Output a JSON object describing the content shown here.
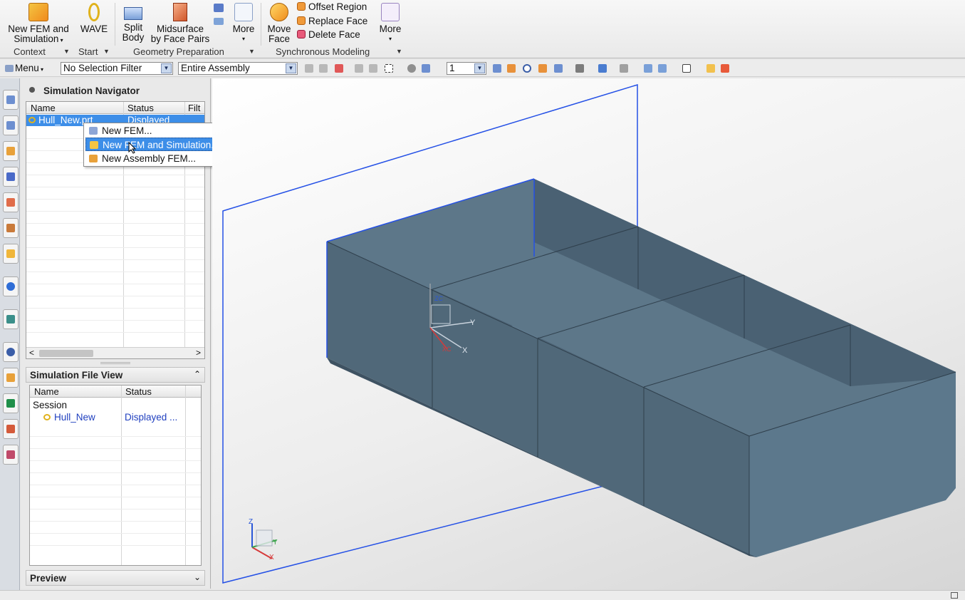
{
  "ribbon": {
    "new_fem_label_1": "New FEM and",
    "new_fem_label_2": "Simulation",
    "wave_label": "WAVE",
    "split_label_1": "Split",
    "split_label_2": "Body",
    "midsurface_label_1": "Midsurface",
    "midsurface_label_2": "by Face Pairs",
    "more1_label": "More",
    "move_face_label_1": "Move",
    "move_face_label_2": "Face",
    "offset_region": "Offset Region",
    "replace_face": "Replace Face",
    "delete_face": "Delete Face",
    "more2_label": "More",
    "groups": {
      "context": "Context",
      "start": "Start",
      "geometry_preparation": "Geometry Preparation",
      "synchronous_modeling": "Synchronous Modeling"
    }
  },
  "selection_bar": {
    "menu_label": "Menu",
    "filter_value": "No Selection Filter",
    "scope_value": "Entire Assembly",
    "layer_value": "1"
  },
  "sim_navigator": {
    "title": "Simulation Navigator",
    "columns": [
      "Name",
      "Status",
      "Filt"
    ],
    "row_name": "Hull_New.prt",
    "row_status": "Displayed"
  },
  "context_menu": {
    "items": [
      "New FEM...",
      "New FEM and Simulation...",
      "New Assembly FEM..."
    ]
  },
  "file_view": {
    "title": "Simulation File View",
    "columns": [
      "Name",
      "Status"
    ],
    "session_label": "Session",
    "file_name": "Hull_New",
    "file_status": "Displayed ..."
  },
  "preview": {
    "title": "Preview"
  },
  "view_triad": {
    "x": "X",
    "y": "Y",
    "z": "Z",
    "zc": "ZC",
    "xc": "XC",
    "y_small": "Y"
  },
  "colors": {
    "hull_light": "#5f7a8e",
    "hull_dark": "#4a6173",
    "hull_edge": "#2f3f4c",
    "plane_border": "#2450e6",
    "menu_highlight": "#3d8ee8"
  }
}
